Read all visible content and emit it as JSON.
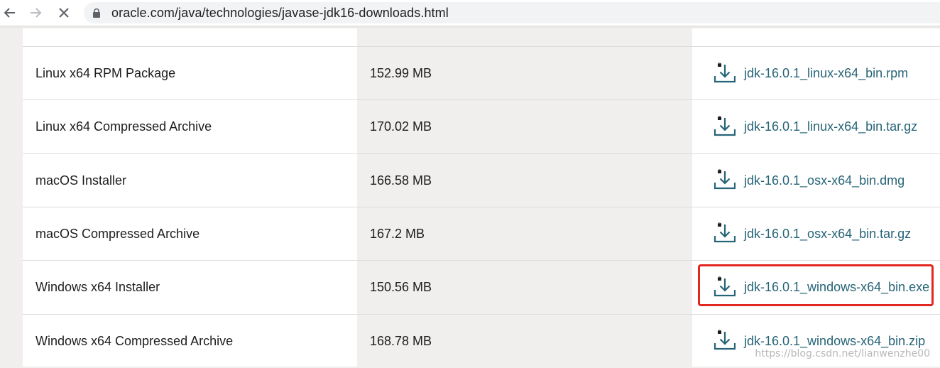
{
  "browser": {
    "url": "oracle.com/java/technologies/javase-jdk16-downloads.html"
  },
  "icons": {
    "back": "arrow-left-icon",
    "forward": "arrow-right-icon",
    "stop": "close-icon",
    "lock": "lock-icon",
    "download": "download-icon"
  },
  "colors": {
    "link": "#266477",
    "highlight": "#e3261f",
    "size_column_bg": "#f1efed"
  },
  "rows": [
    {
      "product": "Linux x64 RPM Package",
      "size": "152.99 MB",
      "download": "jdk-16.0.1_linux-x64_bin.rpm"
    },
    {
      "product": "Linux x64 Compressed Archive",
      "size": "170.02 MB",
      "download": "jdk-16.0.1_linux-x64_bin.tar.gz"
    },
    {
      "product": "macOS Installer",
      "size": "166.58 MB",
      "download": "jdk-16.0.1_osx-x64_bin.dmg"
    },
    {
      "product": "macOS Compressed Archive",
      "size": "167.2 MB",
      "download": "jdk-16.0.1_osx-x64_bin.tar.gz"
    },
    {
      "product": "Windows x64 Installer",
      "size": "150.56 MB",
      "download": "jdk-16.0.1_windows-x64_bin.exe",
      "highlighted": true
    },
    {
      "product": "Windows x64 Compressed Archive",
      "size": "168.78 MB",
      "download": "jdk-16.0.1_windows-x64_bin.zip"
    }
  ],
  "watermark": "https://blog.csdn.net/lianwenzhe00"
}
